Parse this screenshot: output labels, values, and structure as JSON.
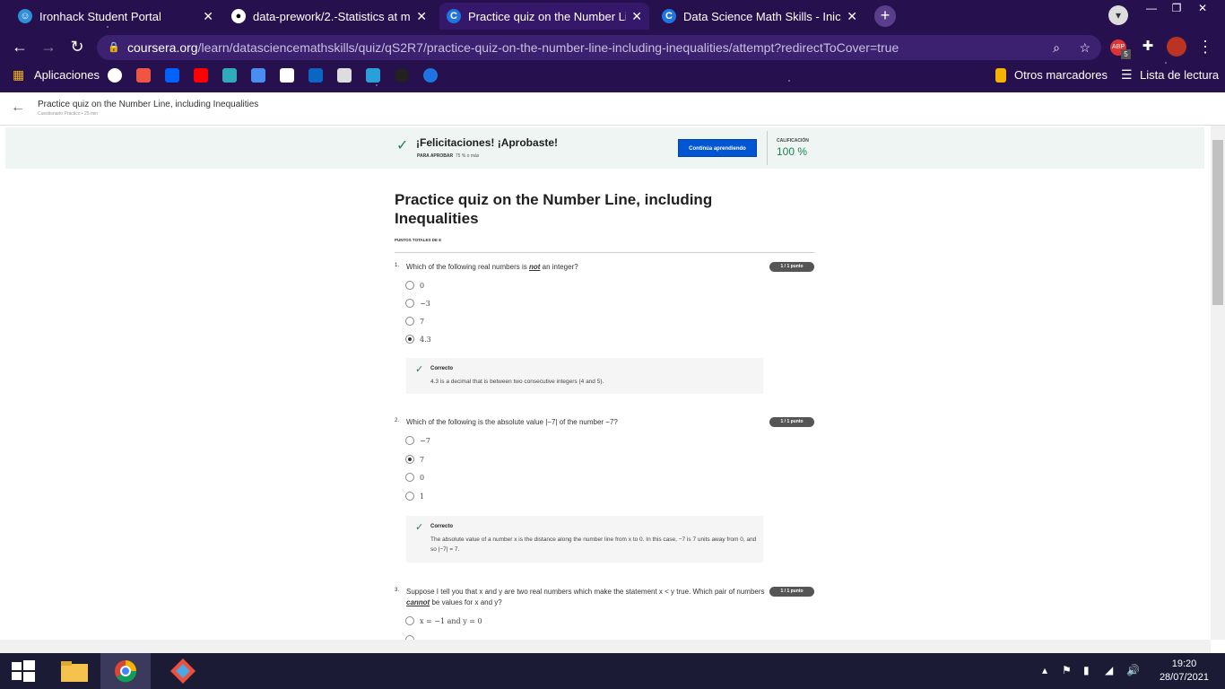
{
  "browser": {
    "tabs": [
      {
        "title": "Ironhack Student Portal",
        "icon": "ironhack-icon",
        "active": false
      },
      {
        "title": "data-prework/2.-Statistics at mas",
        "icon": "github-icon",
        "active": false
      },
      {
        "title": "Practice quiz on the Number Line",
        "icon": "coursera-icon",
        "active": true
      },
      {
        "title": "Data Science Math Skills - Inicio |",
        "icon": "coursera-icon",
        "active": false
      }
    ],
    "url_domain": "coursera.org",
    "url_path": "/learn/datasciencemathskills/quiz/qS2R7/practice-quiz-on-the-number-line-including-inequalities/attempt?redirectToCover=true",
    "bookmarks_apps": "Aplicaciones",
    "other_bookmarks": "Otros marcadores",
    "reading_list": "Lista de lectura",
    "ext_badge": "5"
  },
  "header": {
    "title": "Practice quiz on the Number Line, including Inequalities",
    "subtitle": "Cuestionario Práctico • 25 min"
  },
  "banner": {
    "message": "¡Felicitaciones! ¡Aprobaste!",
    "pass_label": "PARA APROBAR",
    "pass_value": "75 % o más",
    "continue_label": "Continúa aprendiendo",
    "grade_label": "CALIFICACIÓN",
    "grade_value": "100 %"
  },
  "quiz": {
    "title": "Practice quiz on the Number Line, including Inequalities",
    "points": "PUNTOS TOTALES DE 8",
    "questions": [
      {
        "num": "1.",
        "text_a": "Which of the following real numbers is ",
        "text_em": "not",
        "text_b": " an integer?",
        "score": "1 / 1 punto",
        "options": [
          "0",
          "−3",
          "7",
          "4.3"
        ],
        "feedback_title": "Correcto",
        "feedback_text": "4.3 is a decimal that is between two consecutive integers (4 and 5)."
      },
      {
        "num": "2.",
        "text": "Which of the following is the absolute value |−7| of the number −7?",
        "score": "1 / 1 punto",
        "options": [
          "−7",
          "7",
          "0",
          "1"
        ],
        "feedback_title": "Correcto",
        "feedback_text": "The absolute value of a number x is the distance along the number line from x to 0. In this case, −7 is 7 units away from 0, and so |−7| = 7."
      },
      {
        "num": "3.",
        "text_a": "Suppose I tell you that x and y are two real numbers which make the statement x < y true. Which pair of numbers ",
        "text_em": "cannot",
        "text_b": " be values for x and y?",
        "score": "1 / 1 punto",
        "options": [
          "x = −1 and y = 0"
        ]
      }
    ]
  },
  "taskbar": {
    "time": "19:20",
    "date": "28/07/2021"
  }
}
